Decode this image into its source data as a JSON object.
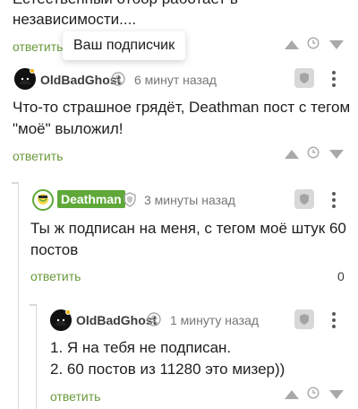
{
  "top_comment": {
    "text_line1": "Естественный отбор работает в",
    "text_line2": "независимости....",
    "reply_label": "ответить",
    "tooltip": "Ваш подписчик"
  },
  "comment1": {
    "author": "OldBadGhost",
    "time": "6 минут назад",
    "text_line1": "Что-то страшное грядёт, Deathman пост с тегом",
    "text_line2": "\"моё\" выложил!",
    "reply_label": "ответить"
  },
  "comment2": {
    "author": "Deathman",
    "time": "3 минуты назад",
    "text_line1": "Ты ж подписан на меня, с тегом моё штук 60",
    "text_line2": "постов",
    "reply_label": "ответить",
    "rating": "0"
  },
  "comment3": {
    "author": "OldBadGhost",
    "time": "1 минуту назад",
    "text_line1": "1. Я на тебя не подписан.",
    "text_line2": "2. 60 постов из 11280 это мизер))",
    "reply_label": "ответить"
  },
  "colors": {
    "accent_green": "#6a9a3b",
    "deathman_badge": "#5fa839"
  },
  "icons": [
    "upvote-icon",
    "clock-icon",
    "downvote-icon",
    "shield-icon",
    "more-vertical-icon",
    "subscriber-icon",
    "thread-collapse-icon"
  ]
}
